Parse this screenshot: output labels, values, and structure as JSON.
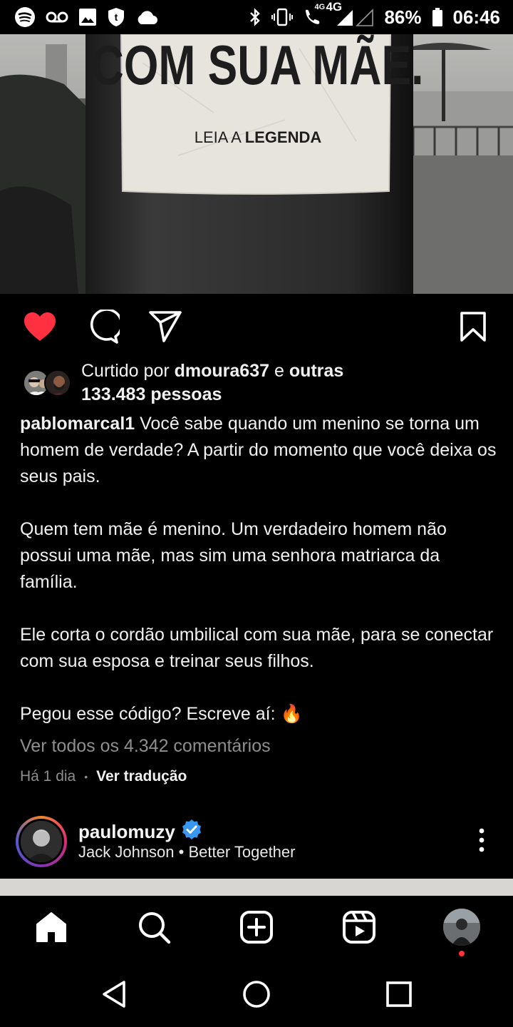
{
  "status_bar": {
    "left_icons": [
      "spotify-icon",
      "voicemail-icon",
      "image-icon",
      "shield-icon",
      "cloud-icon"
    ],
    "right_icons": [
      "bluetooth-icon",
      "vibrate-icon",
      "volte-call-icon",
      "signal-icon"
    ],
    "network_label_1": "4G",
    "network_label_2": "4G",
    "battery": "86%",
    "time": "06:46"
  },
  "post": {
    "image_text_line1": "COM SUA MÃE.",
    "image_text_line2_light": "LEIA A ",
    "image_text_line2_bold": "LEGENDA",
    "likes": {
      "prefix": "Curtido por ",
      "user": "dmoura637",
      "middle": " e ",
      "others": "outras",
      "count": "133.483 pessoas"
    },
    "caption": {
      "username": "pablomarcal1",
      "para1": " Você sabe quando um menino se torna um homem de verdade? A partir do momento que você deixa os seus pais.",
      "para2": "Quem tem mãe é menino. Um verdadeiro homem não possui uma mãe, mas sim uma senhora matriarca da família.",
      "para3": "Ele corta o cordão umbilical com sua mãe, para se conectar com sua esposa e treinar seus filhos.",
      "para4": "Pegou esse código? Escreve aí: 🔥"
    },
    "comments_link": "Ver todos os 4.342 comentários",
    "time_ago": "Há 1 dia",
    "separator": "•",
    "translate": "Ver tradução",
    "liked": true
  },
  "next_post": {
    "username": "paulomuzy",
    "verified": true,
    "music": "Jack Johnson • Better Together"
  },
  "bottom_nav": {
    "items": [
      "home-icon",
      "search-icon",
      "create-icon",
      "reels-icon",
      "profile-avatar"
    ],
    "notification_dot": true
  },
  "colors": {
    "like_red": "#ff3040",
    "verified_blue": "#3897f0",
    "muted_text": "#8e8e8e"
  }
}
